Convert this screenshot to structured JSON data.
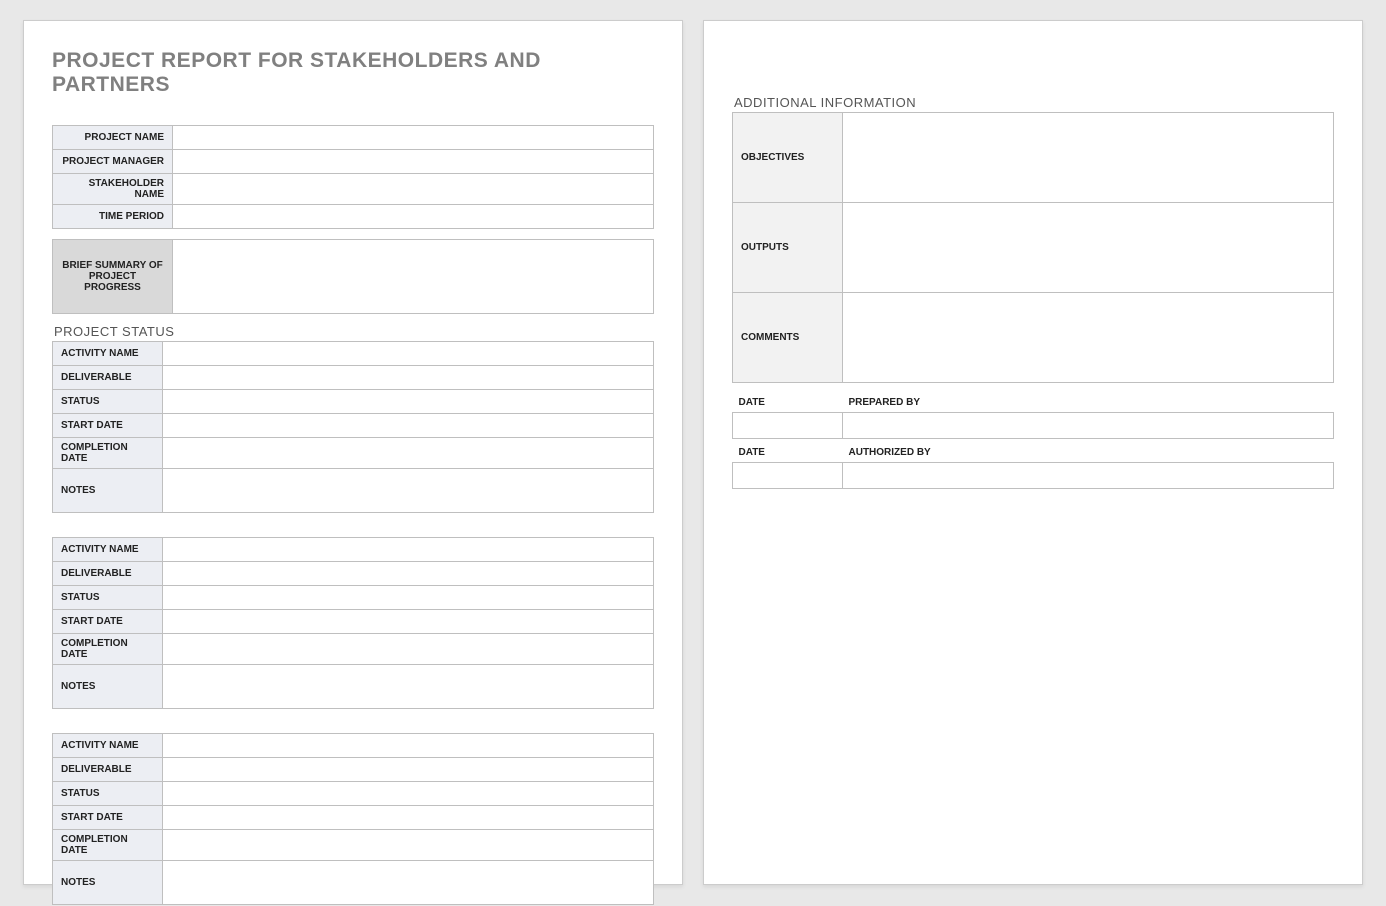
{
  "title": "PROJECT REPORT FOR STAKEHOLDERS AND PARTNERS",
  "header_fields": {
    "project_name": "PROJECT NAME",
    "project_manager": "PROJECT MANAGER",
    "stakeholder_name": "STAKEHOLDER NAME",
    "time_period": "TIME PERIOD"
  },
  "summary_label": "BRIEF SUMMARY OF PROJECT PROGRESS",
  "project_status_header": "PROJECT STATUS",
  "activity_labels": {
    "activity_name": "ACTIVITY NAME",
    "deliverable": "DELIVERABLE",
    "status": "STATUS",
    "start_date": "START DATE",
    "completion_date": "COMPLETION DATE",
    "notes": "NOTES"
  },
  "additional_info_header": "ADDITIONAL INFORMATION",
  "additional_labels": {
    "objectives": "OBJECTIVES",
    "outputs": "OUTPUTS",
    "comments": "COMMENTS"
  },
  "signoff": {
    "date": "DATE",
    "prepared_by": "PREPARED BY",
    "authorized_by": "AUTHORIZED BY"
  }
}
